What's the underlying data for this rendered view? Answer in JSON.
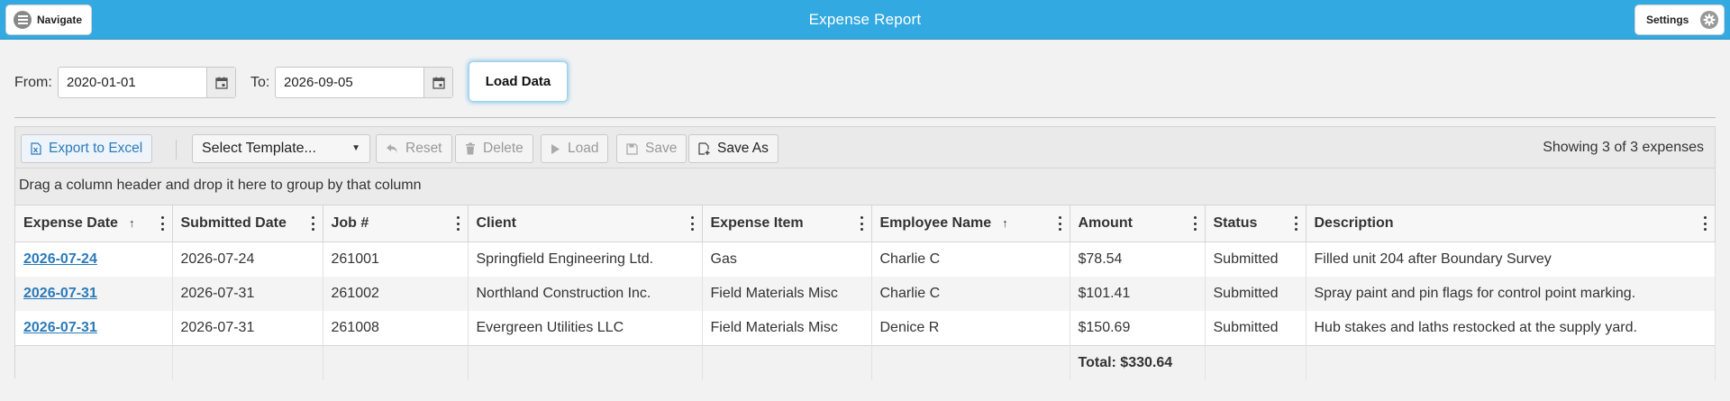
{
  "header": {
    "title": "Expense Report",
    "navigate_label": "Navigate",
    "settings_label": "Settings"
  },
  "filters": {
    "from_label": "From:",
    "from_value": "2020-01-01",
    "to_label": "To:",
    "to_value": "2026-09-05",
    "load_button": "Load Data"
  },
  "toolbar": {
    "export_label": "Export to Excel",
    "template_select": "Select Template...",
    "reset_label": "Reset",
    "delete_label": "Delete",
    "load_label": "Load",
    "save_label": "Save",
    "save_as_label": "Save As",
    "count_text": "Showing 3 of 3 expenses"
  },
  "grid": {
    "group_hint": "Drag a column header and drop it here to group by that column",
    "columns": [
      "Expense Date",
      "Submitted Date",
      "Job #",
      "Client",
      "Expense Item",
      "Employee Name",
      "Amount",
      "Status",
      "Description"
    ],
    "sort_indicator": "↑",
    "rows": [
      {
        "expense_date": "2026-07-24",
        "submitted_date": "2026-07-24",
        "job": "261001",
        "client": "Springfield Engineering Ltd.",
        "item": "Gas",
        "employee": "Charlie C",
        "amount": "$78.54",
        "status": "Submitted",
        "description": "Filled unit 204 after Boundary Survey"
      },
      {
        "expense_date": "2026-07-31",
        "submitted_date": "2026-07-31",
        "job": "261002",
        "client": "Northland Construction Inc.",
        "item": "Field Materials Misc",
        "employee": "Charlie C",
        "amount": "$101.41",
        "status": "Submitted",
        "description": "Spray paint and pin flags for control point marking."
      },
      {
        "expense_date": "2026-07-31",
        "submitted_date": "2026-07-31",
        "job": "261008",
        "client": "Evergreen Utilities LLC",
        "item": "Field Materials Misc",
        "employee": "Denice R",
        "amount": "$150.69",
        "status": "Submitted",
        "description": "Hub stakes and laths restocked at the supply yard."
      }
    ],
    "total_text": "Total: $330.64"
  },
  "colors": {
    "header_bg": "#33a9e1",
    "link": "#2a7ab8",
    "accent_glow": "#33a9e1"
  }
}
